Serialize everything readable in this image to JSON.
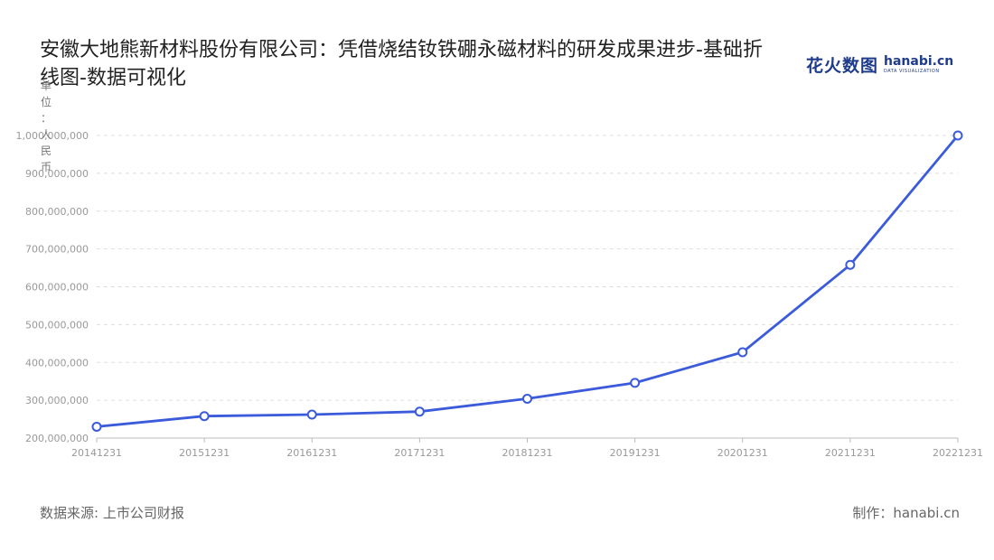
{
  "header": {
    "title": "安徽大地熊新材料股份有限公司：凭借烧结钕铁硼永磁材料的研发成果进步-基础折线图-数据可视化"
  },
  "logo": {
    "cn": "花火数图",
    "en": "hanabi.cn",
    "sub": "DATA VISUALIZATION"
  },
  "footer": {
    "source": "数据来源: 上市公司财报",
    "credit": "制作：hanabi.cn"
  },
  "colors": {
    "line": "#3b5bdb",
    "grid": "#dddddd",
    "axis": "#bbbbbb",
    "tick_text": "#999999"
  },
  "chart_data": {
    "type": "line",
    "title": "安徽大地熊新材料股份有限公司：凭借烧结钕铁硼永磁材料的研发成果进步-基础折线图-数据可视化",
    "ylabel": "单位：人民币",
    "xlabel": "",
    "categories": [
      "20141231",
      "20151231",
      "20161231",
      "20171231",
      "20181231",
      "20191231",
      "20201231",
      "20211231",
      "20221231"
    ],
    "values": [
      230000000,
      258000000,
      262000000,
      270000000,
      304000000,
      346000000,
      427000000,
      658000000,
      1000000000
    ],
    "ylim": [
      200000000,
      1000000000
    ],
    "yticks": [
      200000000,
      300000000,
      400000000,
      500000000,
      600000000,
      700000000,
      800000000,
      900000000,
      1000000000
    ],
    "ytick_labels": [
      "200,000,000",
      "300,000,000",
      "400,000,000",
      "500,000,000",
      "600,000,000",
      "700,000,000",
      "800,000,000",
      "900,000,000",
      "1,000,000,000"
    ],
    "grid": true,
    "legend": "none"
  }
}
